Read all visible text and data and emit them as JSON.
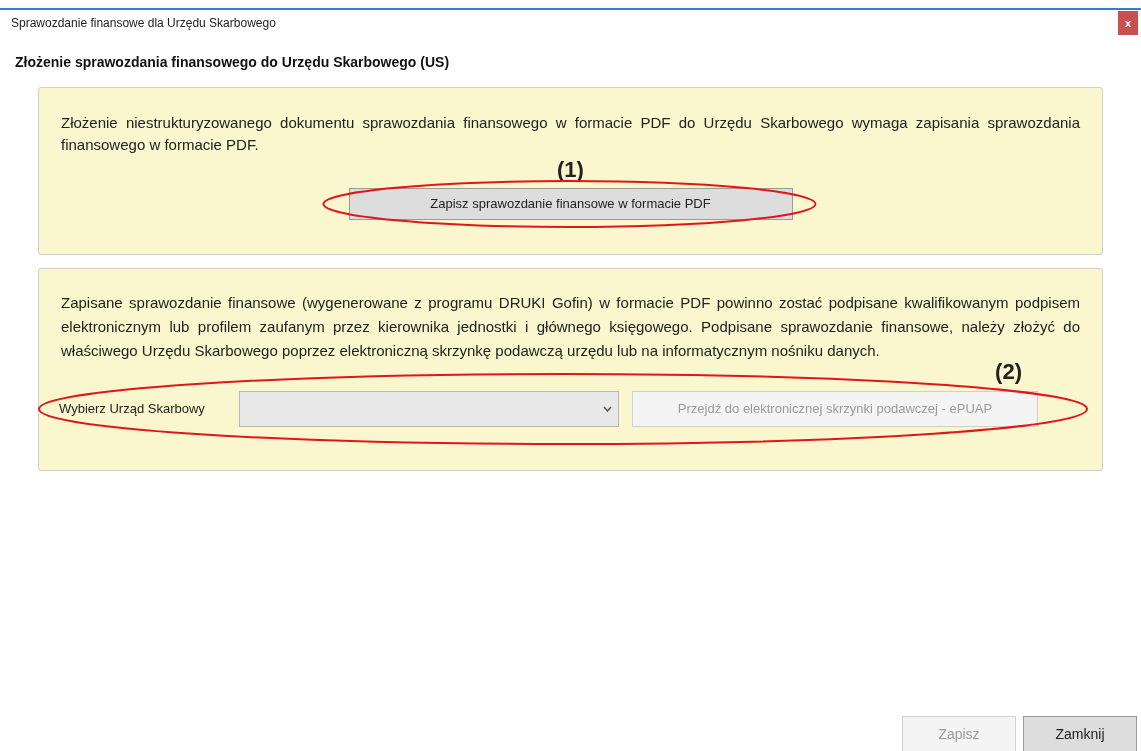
{
  "window": {
    "title": "Sprawozdanie finansowe dla Urzędu Skarbowego",
    "close": "x"
  },
  "heading": "Złożenie sprawozdania finansowego do Urzędu Skarbowego (US)",
  "panel_1": {
    "text": "Złożenie niestrukturyzowanego dokumentu sprawozdania finansowego w formacie PDF do Urzędu Skarbowego wymaga zapisania sprawozdania finansowego w formacie PDF.",
    "marker": "(1)",
    "button": {
      "label": "Zapisz sprawozdanie finansowe w formacie PDF",
      "disabled": false
    }
  },
  "panel_2": {
    "text": "Zapisane sprawozdanie finansowe (wygenerowane z programu DRUKI Gofin) w formacie PDF powinno zostać podpisane kwalifikowanym podpisem elektronicznym lub profilem zaufanym przez kierownika jednostki i głównego księgowego. Podpisane sprawozdanie finansowe, należy złożyć do właściwego Urzędu Skarbowego poprzez elektroniczną skrzynkę podawczą urzędu lub na informatycznym nośniku danych.",
    "marker": "(2)",
    "select_label": "Wybierz Urząd Skarbowy",
    "button": {
      "label": "Przejdź do elektronicznej skrzynki podawczej - ePUAP",
      "disabled": true
    }
  },
  "footer_buttons": [
    {
      "label": "Zapisz",
      "disabled": true
    },
    {
      "label": "Zamknij",
      "disabled": false
    }
  ]
}
